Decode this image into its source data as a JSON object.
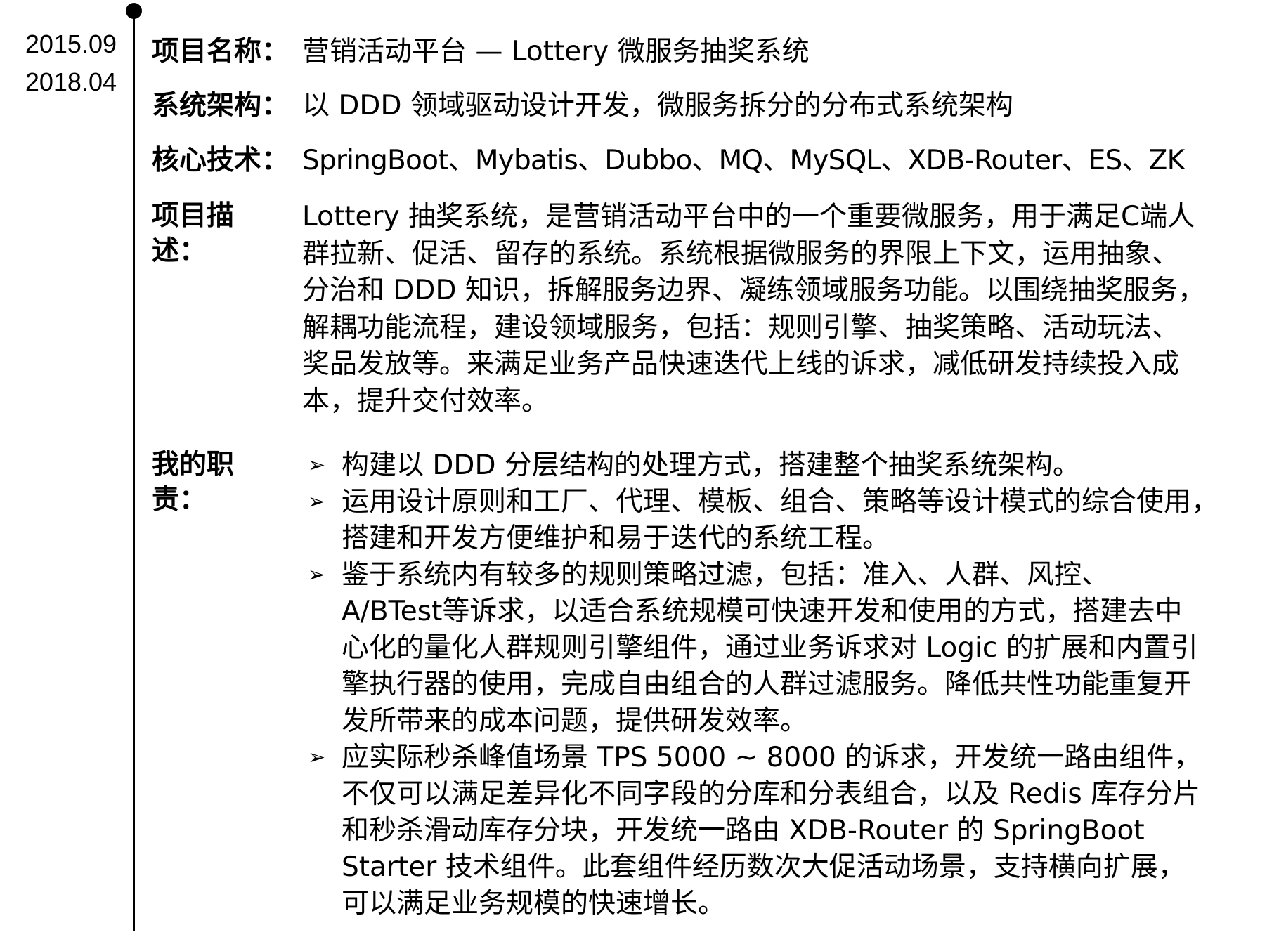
{
  "dates": {
    "start": "2015.09",
    "end": "2018.04"
  },
  "project": {
    "name_label": "项目名称：",
    "name_value": "营销活动平台 — Lottery 微服务抽奖系统",
    "arch_label": "系统架构：",
    "arch_value": "以 DDD 领域驱动设计开发，微服务拆分的分布式系统架构",
    "tech_label": "核心技术：",
    "tech_value": "SpringBoot、Mybatis、Dubbo、MQ、MySQL、XDB-Router、ES、ZK",
    "desc_label": "项目描述：",
    "desc_lines": [
      "Lottery 抽奖系统，是营销活动平台中的一个重要微服务，用于满足C端人",
      "群拉新、促活、留存的系统。系统根据微服务的界限上下文，运用抽象、",
      "分治和 DDD 知识，拆解服务边界、凝练领域服务功能。以围绕抽奖服务，",
      "解耦功能流程，建设领域服务，包括：规则引擎、抽奖策略、活动玩法、",
      "奖品发放等。来满足业务产品快速迭代上线的诉求，减低研发持续投入成",
      "本，提升交付效率。"
    ],
    "duty_label": "我的职责：",
    "duties": [
      {
        "lines": [
          "构建以 DDD 分层结构的处理方式，搭建整个抽奖系统架构。"
        ]
      },
      {
        "lines": [
          "运用设计原则和工厂、代理、模板、组合、策略等设计模式的综合使用，",
          "搭建和开发方便维护和易于迭代的系统工程。"
        ]
      },
      {
        "lines": [
          "鉴于系统内有较多的规则策略过滤，包括：准入、人群、风控、",
          "A/BTest等诉求，以适合系统规模可快速开发和使用的方式，搭建去中",
          "心化的量化人群规则引擎组件，通过业务诉求对 Logic 的扩展和内置引",
          "擎执行器的使用，完成自由组合的人群过滤服务。降低共性功能重复开",
          "发所带来的成本问题，提供研发效率。"
        ]
      },
      {
        "lines": [
          "应实际秒杀峰值场景 TPS 5000 ~ 8000 的诉求，开发统一路由组件，",
          "不仅可以满足差异化不同字段的分库和分表组合，以及 Redis 库存分片",
          "和秒杀滑动库存分块，开发统一路由 XDB-Router 的 SpringBoot",
          "Starter 技术组件。此套组件经历数次大促活动场景，支持横向扩展，",
          "可以满足业务规模的快速增长。"
        ]
      }
    ],
    "bullet_glyph": "➢"
  }
}
